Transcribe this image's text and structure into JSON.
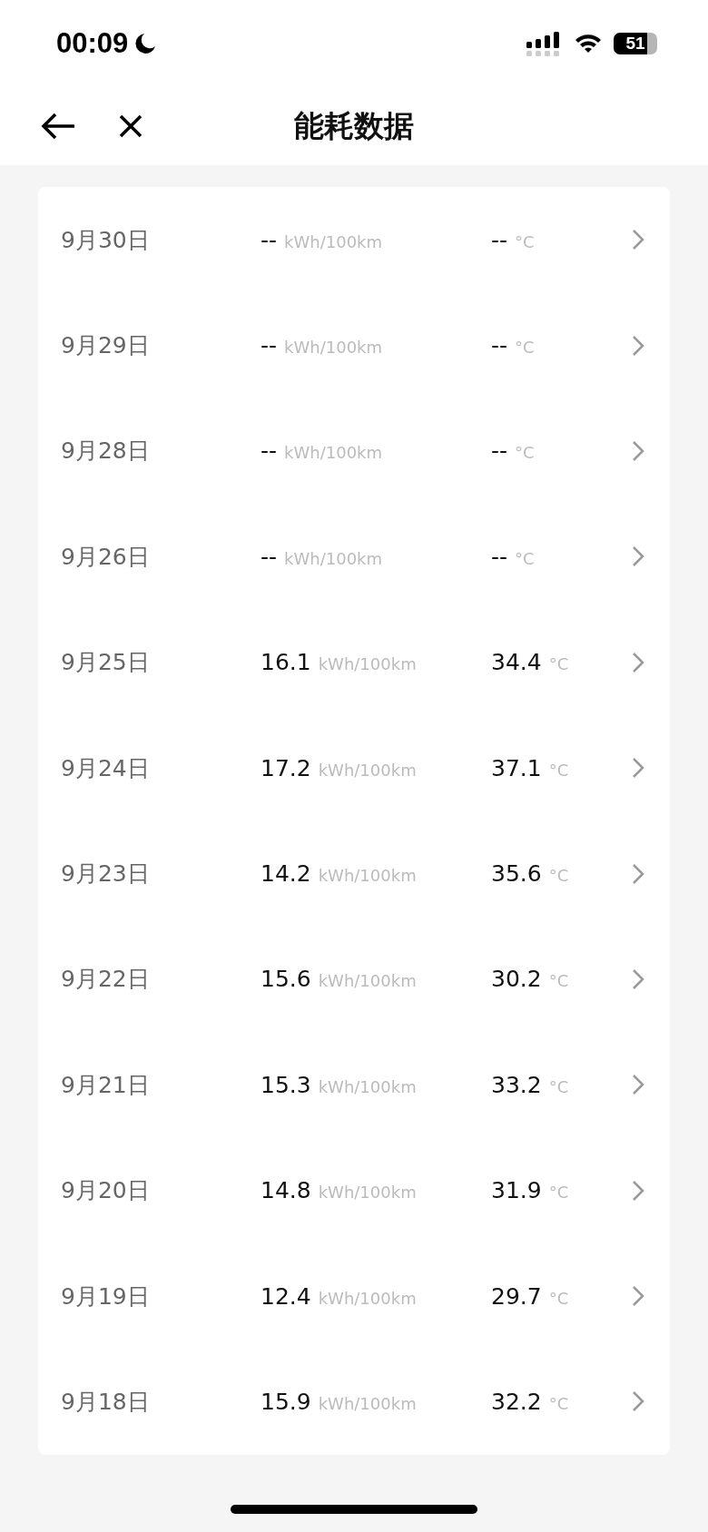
{
  "status_bar": {
    "time": "00:09",
    "battery": "51"
  },
  "nav": {
    "title": "能耗数据"
  },
  "records": [
    {
      "date": "9月30日",
      "consumption": "--",
      "consumption_unit": "kWh/100km",
      "temperature": "--",
      "temperature_unit": "°C"
    },
    {
      "date": "9月29日",
      "consumption": "--",
      "consumption_unit": "kWh/100km",
      "temperature": "--",
      "temperature_unit": "°C"
    },
    {
      "date": "9月28日",
      "consumption": "--",
      "consumption_unit": "kWh/100km",
      "temperature": "--",
      "temperature_unit": "°C"
    },
    {
      "date": "9月26日",
      "consumption": "--",
      "consumption_unit": "kWh/100km",
      "temperature": "--",
      "temperature_unit": "°C"
    },
    {
      "date": "9月25日",
      "consumption": "16.1",
      "consumption_unit": "kWh/100km",
      "temperature": "34.4",
      "temperature_unit": "°C"
    },
    {
      "date": "9月24日",
      "consumption": "17.2",
      "consumption_unit": "kWh/100km",
      "temperature": "37.1",
      "temperature_unit": "°C"
    },
    {
      "date": "9月23日",
      "consumption": "14.2",
      "consumption_unit": "kWh/100km",
      "temperature": "35.6",
      "temperature_unit": "°C"
    },
    {
      "date": "9月22日",
      "consumption": "15.6",
      "consumption_unit": "kWh/100km",
      "temperature": "30.2",
      "temperature_unit": "°C"
    },
    {
      "date": "9月21日",
      "consumption": "15.3",
      "consumption_unit": "kWh/100km",
      "temperature": "33.2",
      "temperature_unit": "°C"
    },
    {
      "date": "9月20日",
      "consumption": "14.8",
      "consumption_unit": "kWh/100km",
      "temperature": "31.9",
      "temperature_unit": "°C"
    },
    {
      "date": "9月19日",
      "consumption": "12.4",
      "consumption_unit": "kWh/100km",
      "temperature": "29.7",
      "temperature_unit": "°C"
    },
    {
      "date": "9月18日",
      "consumption": "15.9",
      "consumption_unit": "kWh/100km",
      "temperature": "32.2",
      "temperature_unit": "°C"
    }
  ]
}
